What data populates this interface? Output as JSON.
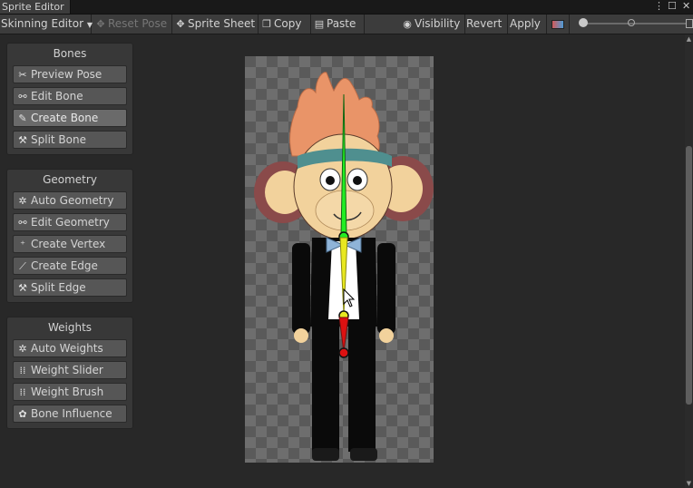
{
  "window": {
    "title": "Sprite Editor",
    "controls": [
      "⋮",
      "☐",
      "✕"
    ]
  },
  "toolbar": {
    "mode_label": "Skinning Editor",
    "reset_pose": "Reset Pose",
    "sprite_sheet": "Sprite Sheet",
    "copy": "Copy",
    "paste": "Paste",
    "visibility": "Visibility",
    "revert": "Revert",
    "apply": "Apply"
  },
  "panels": {
    "bones": {
      "title": "Bones",
      "items": [
        {
          "label": "Preview Pose",
          "icon": "preview-pose-icon",
          "active": false
        },
        {
          "label": "Edit Bone",
          "icon": "edit-bone-icon",
          "active": false
        },
        {
          "label": "Create Bone",
          "icon": "create-bone-icon",
          "active": true
        },
        {
          "label": "Split Bone",
          "icon": "split-bone-icon",
          "active": false
        }
      ]
    },
    "geometry": {
      "title": "Geometry",
      "items": [
        {
          "label": "Auto Geometry",
          "icon": "auto-geometry-icon"
        },
        {
          "label": "Edit Geometry",
          "icon": "edit-geometry-icon"
        },
        {
          "label": "Create Vertex",
          "icon": "create-vertex-icon"
        },
        {
          "label": "Create Edge",
          "icon": "create-edge-icon"
        },
        {
          "label": "Split Edge",
          "icon": "split-edge-icon"
        }
      ]
    },
    "weights": {
      "title": "Weights",
      "items": [
        {
          "label": "Auto Weights",
          "icon": "auto-weights-icon"
        },
        {
          "label": "Weight Slider",
          "icon": "weight-slider-icon"
        },
        {
          "label": "Weight Brush",
          "icon": "weight-brush-icon"
        },
        {
          "label": "Bone Influence",
          "icon": "bone-influence-icon"
        }
      ]
    }
  },
  "bones_colors": {
    "head": "#22ee22",
    "torso": "#e8e820",
    "hip": "#dd1111"
  },
  "zoom": {
    "level": 0.3
  }
}
